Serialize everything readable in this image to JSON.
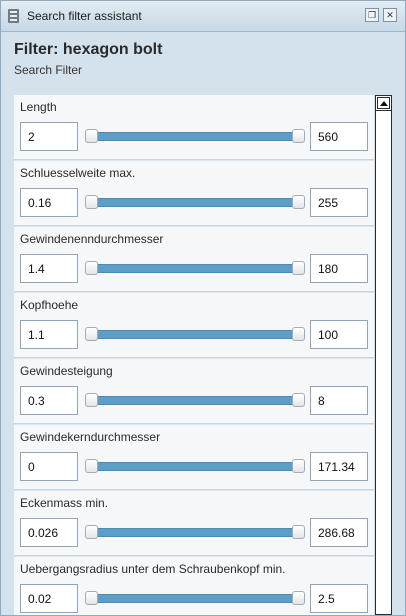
{
  "window": {
    "title": "Search filter assistant",
    "controls": [
      {
        "icon": "restore-icon",
        "glyph": "❐"
      },
      {
        "icon": "close-icon",
        "glyph": "✕"
      }
    ]
  },
  "header": {
    "title": "Filter: hexagon bolt",
    "subtitle": "Search Filter"
  },
  "filters": [
    {
      "label": "Length",
      "min": "2",
      "max": "560"
    },
    {
      "label": "Schluesselweite max.",
      "min": "0.16",
      "max": "255"
    },
    {
      "label": "Gewindenenndurchmesser",
      "min": "1.4",
      "max": "180"
    },
    {
      "label": "Kopfhoehe",
      "min": "1.1",
      "max": "100"
    },
    {
      "label": "Gewindesteigung",
      "min": "0.3",
      "max": "8"
    },
    {
      "label": "Gewindekerndurchmesser",
      "min": "0",
      "max": "171.34"
    },
    {
      "label": "Eckenmass min.",
      "min": "0.026",
      "max": "286.68"
    },
    {
      "label": "Uebergangsradius unter dem Schraubenkopf min.",
      "min": "0.02",
      "max": "2.5"
    }
  ]
}
